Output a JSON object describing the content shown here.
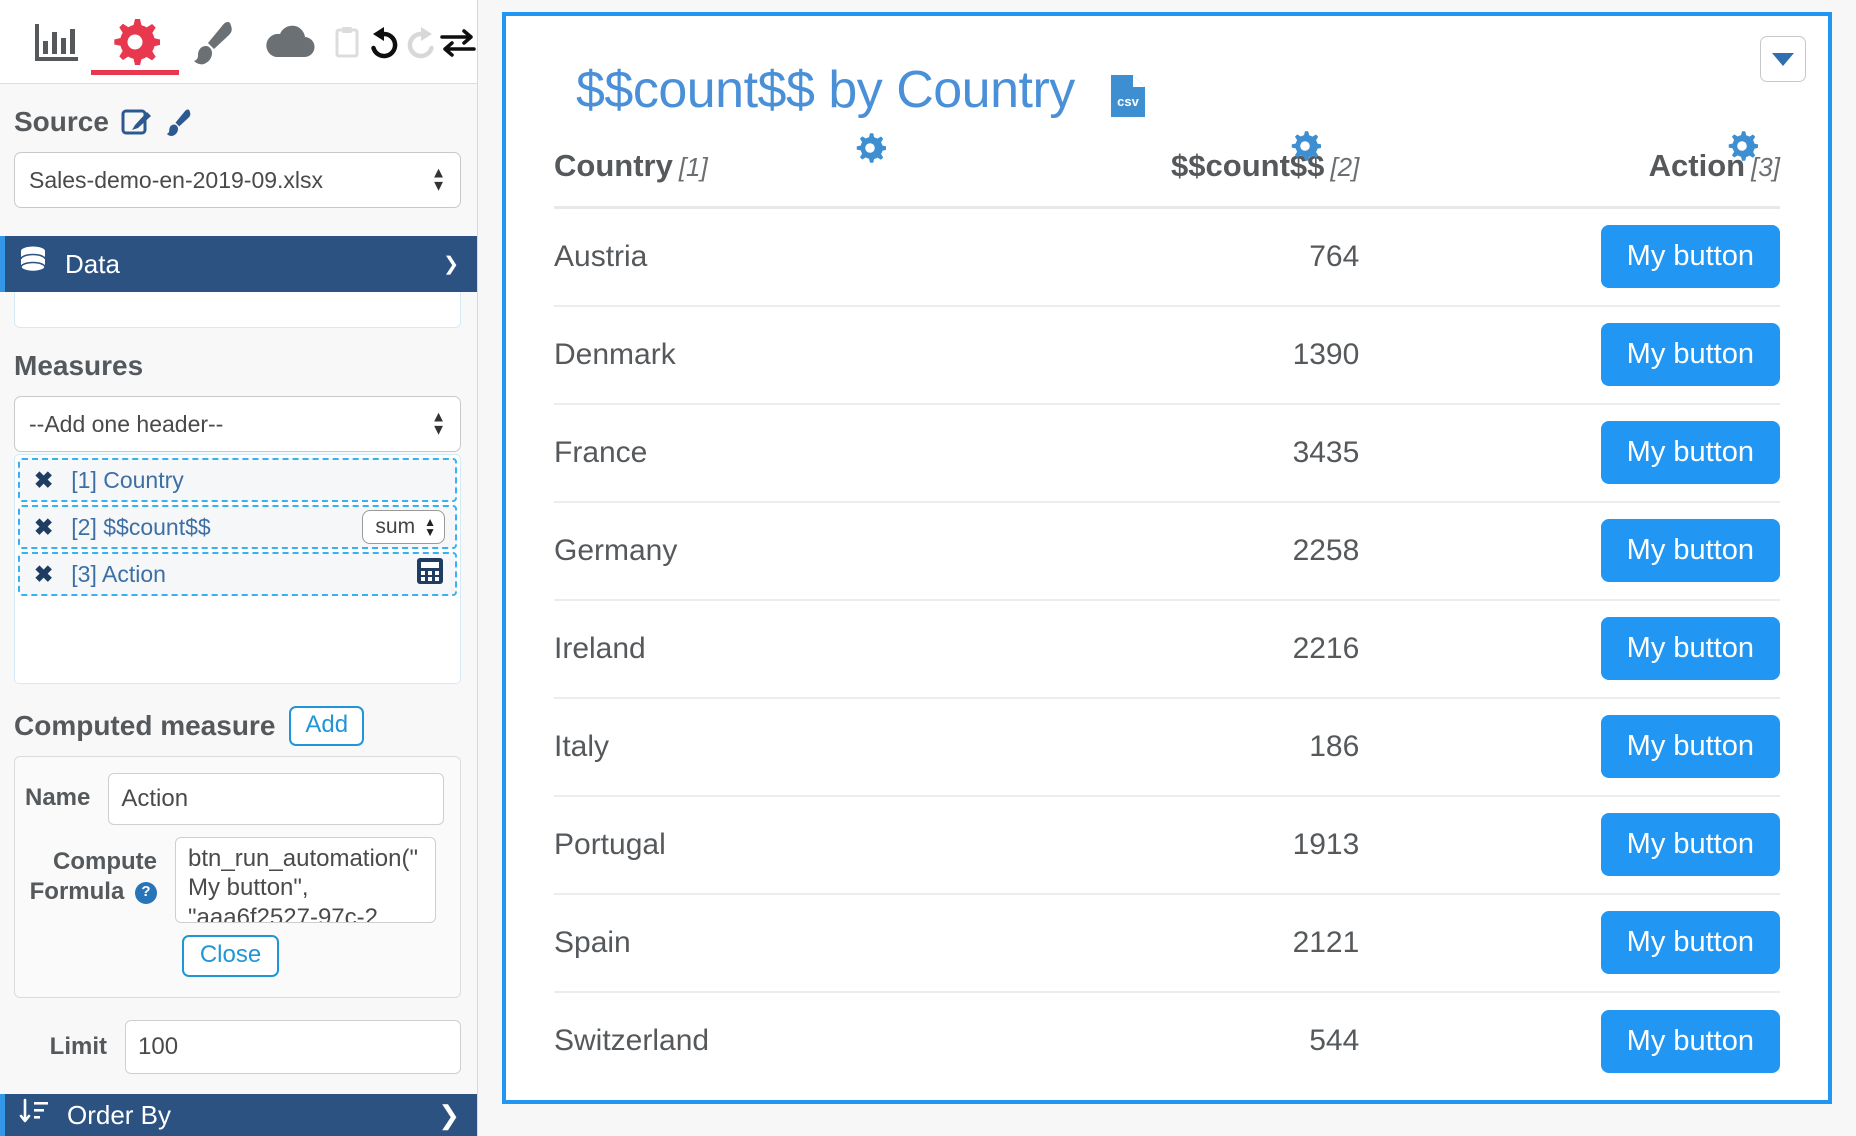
{
  "toolbar": {
    "icons": [
      {
        "name": "chart-icon",
        "label": "Chart"
      },
      {
        "name": "gear-icon",
        "label": "Settings"
      },
      {
        "name": "paintbrush-icon",
        "label": "Style"
      },
      {
        "name": "cloud-icon",
        "label": "Cloud"
      },
      {
        "name": "clipboard-icon",
        "label": "Paste"
      },
      {
        "name": "undo-icon",
        "label": "Undo"
      },
      {
        "name": "redo-icon",
        "label": "Redo"
      },
      {
        "name": "swap-icon",
        "label": "Swap"
      }
    ],
    "active_index": 1
  },
  "sidebar": {
    "source": {
      "label": "Source",
      "edit_icon": "edit-pencil-icon",
      "brush_icon": "paintbrush-icon",
      "selected_value": "Sales-demo-en-2019-09.xlsx"
    },
    "data_panel": {
      "title": "Data",
      "db_icon": "database-icon",
      "chevron": "chevron-down-icon"
    },
    "measures": {
      "label": "Measures",
      "add_header_value": "--Add one header--",
      "items": [
        {
          "label": "[1] Country",
          "remove": "✖",
          "aggregate": null,
          "calc_icon": false
        },
        {
          "label": "[2] $$count$$",
          "remove": "✖",
          "aggregate": "sum",
          "calc_icon": false
        },
        {
          "label": "[3] Action",
          "remove": "✖",
          "aggregate": null,
          "calc_icon": true
        }
      ]
    },
    "computed_measure": {
      "title": "Computed measure",
      "add_label": "Add",
      "name_label": "Name",
      "name_value": "Action",
      "formula_label_line1": "Compute",
      "formula_label_line2": "Formula",
      "formula_help": "?",
      "formula_value": "btn_run_automation(\"My button\", \"aaa6f2527-97c-2",
      "close_label": "Close"
    },
    "limit": {
      "label": "Limit",
      "value": "100"
    },
    "order_by": {
      "label": "Order By",
      "sort_icon": "sort-icon",
      "chevron": "chevron-right-icon"
    }
  },
  "main": {
    "caret_button": "chevron-down-icon",
    "title": "$$count$$ by Country",
    "csv_icon": "csv-file-icon",
    "csv_text": "csv",
    "table": {
      "headers": [
        {
          "label": "Country",
          "index": "[1]",
          "gear": "gear-icon"
        },
        {
          "label": "$$count$$",
          "index": "[2]",
          "gear": "gear-icon"
        },
        {
          "label": "Action",
          "index": "[3]",
          "gear": "gear-icon"
        }
      ],
      "rows": [
        {
          "country": "Austria",
          "count": "764",
          "action": "My button"
        },
        {
          "country": "Denmark",
          "count": "1390",
          "action": "My button"
        },
        {
          "country": "France",
          "count": "3435",
          "action": "My button"
        },
        {
          "country": "Germany",
          "count": "2258",
          "action": "My button"
        },
        {
          "country": "Ireland",
          "count": "2216",
          "action": "My button"
        },
        {
          "country": "Italy",
          "count": "186",
          "action": "My button"
        },
        {
          "country": "Portugal",
          "count": "1913",
          "action": "My button"
        },
        {
          "country": "Spain",
          "count": "2121",
          "action": "My button"
        },
        {
          "country": "Switzerland",
          "count": "544",
          "action": "My button"
        }
      ]
    }
  },
  "colors": {
    "accent_blue": "#2196f3",
    "title_blue": "#4a90d9",
    "panel_navy": "#2c5282",
    "active_red": "#e8384f",
    "text_grey": "#55595c"
  }
}
